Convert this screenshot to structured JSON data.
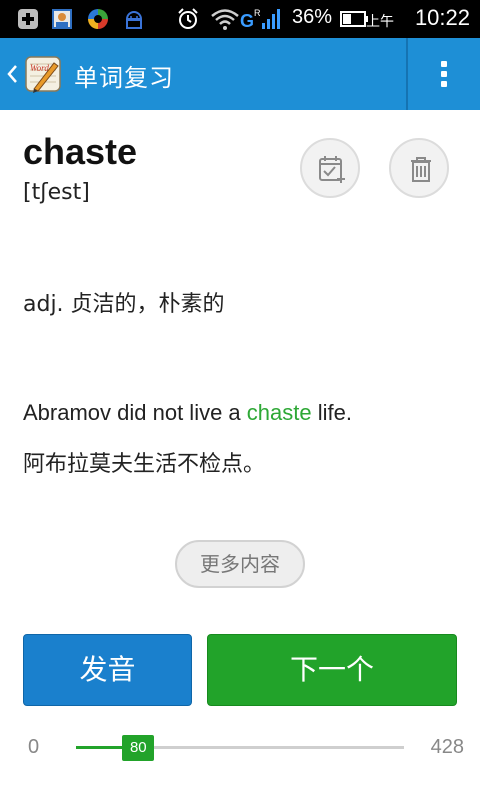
{
  "status_bar": {
    "battery_percent": "36%",
    "am_pm": "上午",
    "time": "10:22",
    "icons": [
      "add-icon",
      "contact-card-icon",
      "circular-app-icon",
      "robot-icon",
      "alarm-icon",
      "wifi-icon",
      "signal-icon",
      "battery-icon"
    ]
  },
  "action_bar": {
    "title": "单词复习",
    "background": "#1e8fd6",
    "icons": [
      "back-chevron-icon",
      "app-logo-icon",
      "overflow-menu-icon"
    ]
  },
  "word": {
    "text": "chaste",
    "phonetic": "[tʃest]"
  },
  "actions": {
    "icons": [
      "calendar-check-add-icon",
      "trash-icon"
    ]
  },
  "definition": {
    "text": "adj. 贞洁的，朴素的"
  },
  "example": {
    "en_before": "Abramov did not live a ",
    "en_highlight": "chaste",
    "en_after": " life.",
    "zh": "阿布拉莫夫生活不检点。",
    "highlight_color": "#2ea836"
  },
  "more_button": {
    "label": "更多内容"
  },
  "buttons": {
    "play_label": "发音",
    "next_label": "下一个",
    "play_color": "#1a80cd",
    "next_color": "#22a32a"
  },
  "progress": {
    "min": "0",
    "max": "428",
    "current": "80",
    "fraction": 0.19
  }
}
